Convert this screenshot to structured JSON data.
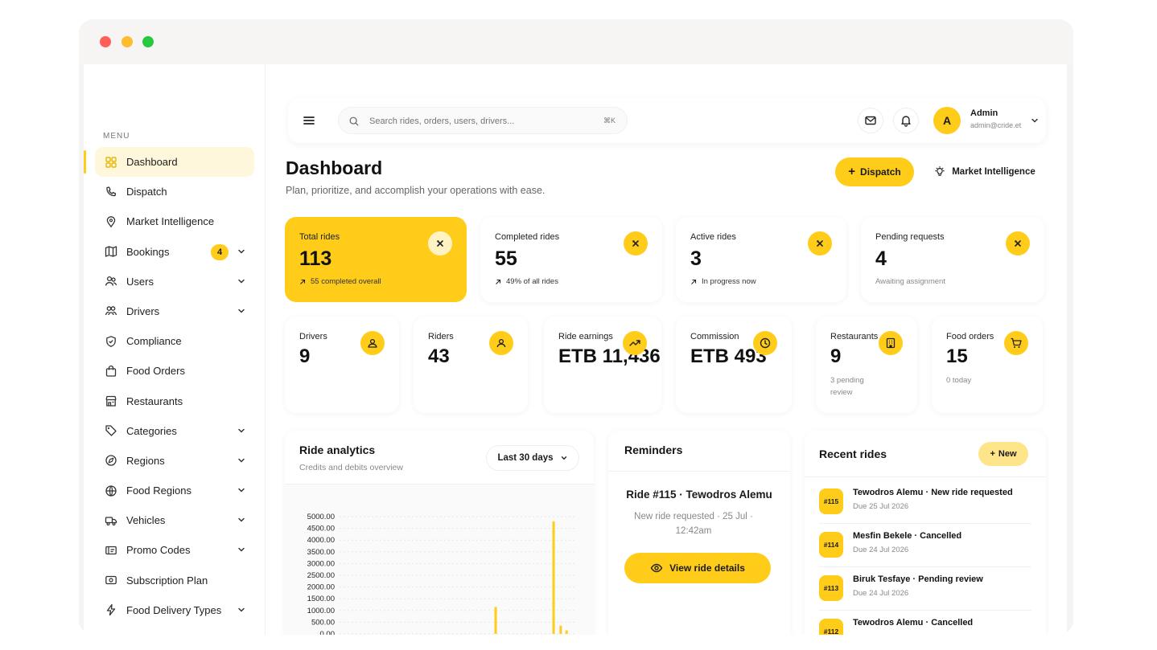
{
  "window": {
    "dots": [
      "#ff5f57",
      "#febc2e",
      "#28c840"
    ]
  },
  "sidebar": {
    "menu_label": "MENU",
    "items": [
      {
        "label": "Dashboard",
        "icon": "grid-icon",
        "active": true
      },
      {
        "label": "Dispatch",
        "icon": "phone-icon"
      },
      {
        "label": "Market Intelligence",
        "icon": "bulb-icon"
      },
      {
        "label": "Bookings",
        "icon": "map-icon",
        "badge": "4",
        "chevron": true
      },
      {
        "label": "Users",
        "icon": "users-icon",
        "chevron": true
      },
      {
        "label": "Drivers",
        "icon": "drivers-icon",
        "chevron": true
      },
      {
        "label": "Compliance",
        "icon": "shield-icon"
      },
      {
        "label": "Food Orders",
        "icon": "bag-icon"
      },
      {
        "label": "Restaurants",
        "icon": "store-icon"
      },
      {
        "label": "Categories",
        "icon": "tag-icon",
        "chevron": true
      },
      {
        "label": "Regions",
        "icon": "compass-icon",
        "chevron": true
      },
      {
        "label": "Food Regions",
        "icon": "globe-icon",
        "chevron": true
      },
      {
        "label": "Vehicles",
        "icon": "truck-icon",
        "chevron": true
      },
      {
        "label": "Promo Codes",
        "icon": "ticket-icon",
        "chevron": true
      },
      {
        "label": "Subscription Plan",
        "icon": "money-icon"
      },
      {
        "label": "Food Delivery Types",
        "icon": "bolt-icon",
        "chevron": true
      }
    ]
  },
  "topbar": {
    "search_placeholder": "Search rides, orders, users, drivers...",
    "shortcut": "⌘K",
    "user": {
      "initial": "A",
      "name": "Admin",
      "email": "admin@cride.et"
    }
  },
  "header": {
    "title": "Dashboard",
    "subtitle": "Plan, prioritize, and accomplish your operations with ease.",
    "dispatch_label": "Dispatch",
    "mi_label": "Market Intelligence"
  },
  "stats_top": [
    {
      "label": "Total rides",
      "value": "113",
      "note": "55 completed overall",
      "arrow": true
    },
    {
      "label": "Completed rides",
      "value": "55",
      "note": "49% of all rides",
      "arrow": true
    },
    {
      "label": "Active rides",
      "value": "3",
      "note": "In progress now",
      "arrow": true
    },
    {
      "label": "Pending requests",
      "value": "4",
      "note": "Awaiting assignment",
      "arrow": false
    }
  ],
  "stats_bottom": [
    {
      "label": "Drivers",
      "value": "9",
      "note": "",
      "icon": "driver-icon"
    },
    {
      "label": "Riders",
      "value": "43",
      "note": "",
      "icon": "rider-icon"
    },
    {
      "label": "Ride earnings",
      "value": "ETB 11,436",
      "note": "",
      "icon": "trend-icon"
    },
    {
      "label": "Commission",
      "value": "ETB 493",
      "note": "",
      "icon": "clock-icon"
    },
    {
      "label": "Restaurants",
      "value": "9",
      "note": "3 pending review",
      "icon": "building-icon"
    },
    {
      "label": "Food orders",
      "value": "15",
      "note": "0 today",
      "icon": "cart-icon"
    }
  ],
  "analytics": {
    "title": "Ride analytics",
    "subtitle": "Credits and debits overview",
    "range": "Last 30 days"
  },
  "chart_data": {
    "type": "bar",
    "title": "",
    "xlabel": "",
    "ylabel": "",
    "ylim": [
      0,
      5000
    ],
    "yticks": [
      "5000.00",
      "4500.00",
      "4000.00",
      "3500.00",
      "3000.00",
      "2500.00",
      "2000.00",
      "1500.00",
      "1000.00",
      "500.00",
      "0.00"
    ],
    "bars": [
      {
        "x": 0.66,
        "value": 1150
      },
      {
        "x": 0.905,
        "value": 4800
      },
      {
        "x": 0.935,
        "value": 350
      },
      {
        "x": 0.96,
        "value": 150
      }
    ],
    "color": "#ffcc1a",
    "grid": true
  },
  "reminders": {
    "title": "Reminders",
    "ride_id": "Ride #115",
    "rider": "Tewodros Alemu",
    "detail": "New ride requested · 25 Jul · 12:42am",
    "button": "View ride details"
  },
  "recent": {
    "title": "Recent rides",
    "new_label": "New",
    "rides": [
      {
        "id": "#115",
        "name": "Tewodros Alemu",
        "status": "New ride requested",
        "due": "Due 25 Jul 2026"
      },
      {
        "id": "#114",
        "name": "Mesfin Bekele",
        "status": "Cancelled",
        "due": "Due 24 Jul 2026"
      },
      {
        "id": "#113",
        "name": "Biruk Tesfaye",
        "status": "Pending review",
        "due": "Due 24 Jul 2026"
      },
      {
        "id": "#112",
        "name": "Tewodros Alemu",
        "status": "Cancelled",
        "due": ""
      }
    ]
  }
}
